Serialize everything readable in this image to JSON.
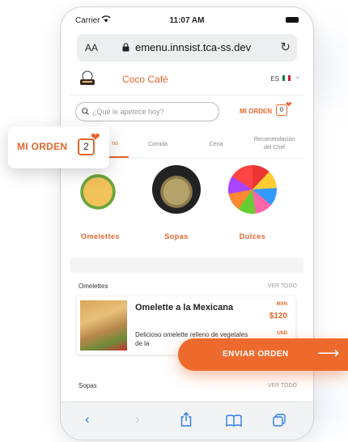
{
  "statusbar": {
    "carrier": "Carrier",
    "time": "11:07 AM"
  },
  "browser": {
    "text_size": "AA",
    "url": "emenu.innsist.tca-ss.dev"
  },
  "header": {
    "cafe_name": "Coco Café",
    "language": "ES"
  },
  "search": {
    "placeholder": "¿Qué le apetece hoy?"
  },
  "order": {
    "label": "MI ORDEN",
    "count_header": "0",
    "count_floating": "2"
  },
  "tabs": [
    {
      "label": "no"
    },
    {
      "label": "Comida"
    },
    {
      "label": "Cena"
    },
    {
      "label": "Recomendación del Chef"
    }
  ],
  "categories": [
    {
      "label": "Omelettes"
    },
    {
      "label": "Sopas"
    },
    {
      "label": "Dulces"
    }
  ],
  "sections": [
    {
      "title": "Omelettes",
      "action": "VER TODO"
    },
    {
      "title": "Sopas",
      "action": "VER TODO"
    }
  ],
  "product": {
    "name": "Omelette a la Mexicana",
    "currency_1": "MXN",
    "price": "$120",
    "description": "Delicioso omelette relleno de vegetales de la",
    "currency_2": "USD"
  },
  "cta": {
    "label": "ENVIAR ORDEN"
  },
  "colors": {
    "accent": "#e5662c",
    "cta": "#ee6a2c",
    "link": "#2d7be5"
  }
}
